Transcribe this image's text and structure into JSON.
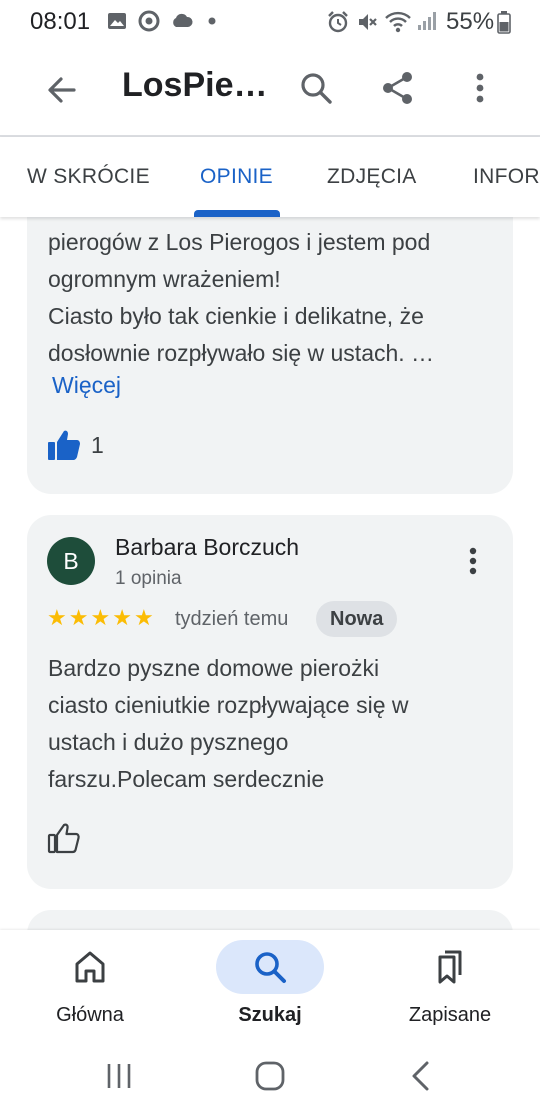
{
  "status_bar": {
    "time": "08:01",
    "battery": "55%"
  },
  "app_bar": {
    "title": "LosPie…"
  },
  "tabs": [
    {
      "label": "W SKRÓCIE",
      "active": false
    },
    {
      "label": "OPINIE",
      "active": true
    },
    {
      "label": "ZDJĘCIA",
      "active": false
    },
    {
      "label": "INFOR",
      "active": false
    }
  ],
  "reviews": [
    {
      "text": "pierogów z Los Pierogos i jestem pod\nogromnym wrażeniem!\nCiasto było tak cienkie i delikatne, że\ndosłownie rozpływało się w ustach. …",
      "more_label": "Więcej",
      "likes": "1"
    },
    {
      "avatar_letter": "B",
      "author": "Barbara Borczuch",
      "author_sub": "1 opinia",
      "rating": 5,
      "time": "tydzień temu",
      "badge": "Nowa",
      "text": "Bardzo pyszne domowe pierożki\nciasto cieniutkie rozpływające się w\nustach i dużo pysznego\nfarszu.Polecam serdecznie"
    }
  ],
  "bottom_nav": [
    {
      "label": "Główna",
      "icon": "home-icon",
      "active": false
    },
    {
      "label": "Szukaj",
      "icon": "search-icon",
      "active": true
    },
    {
      "label": "Zapisane",
      "icon": "bookmarks-icon",
      "active": false
    }
  ],
  "colors": {
    "accent": "#1a62c7",
    "card_bg": "#f1f3f4",
    "star": "#fbbc04",
    "avatar_bg": "#1e4d3a",
    "nav_pill": "#dbe7fb"
  }
}
